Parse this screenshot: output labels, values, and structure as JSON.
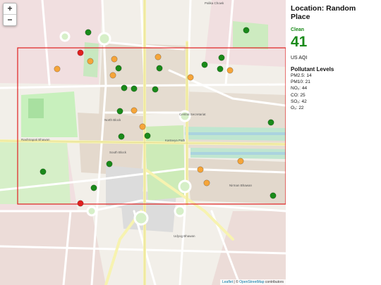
{
  "panel": {
    "location_title": "Location: Random Place",
    "aqi_category": "Clean",
    "aqi_value": "41",
    "aqi_unit": "US AQI",
    "pollutants_heading": "Pollutant Levels",
    "pollutants": [
      "PM2.5: 14",
      "PM10: 21",
      "NO₂: 44",
      "CO: 25",
      "SO₂: 42",
      "O₃: 22"
    ]
  },
  "map": {
    "zoom_in_label": "+",
    "zoom_out_label": "−",
    "attribution": {
      "leaflet": "Leaflet",
      "separator": " | © ",
      "osm": "OpenStreetMap",
      "contributors": " contributors"
    },
    "labels": {
      "palika_chowk": "Palika Chowk",
      "central_secretariat": "Central Secretariat",
      "kartavya_path": "Kartavya Path",
      "udyog_bhawan": "Udyog Bhawan",
      "north_block": "North Block",
      "south_block": "South Block",
      "rashtrapati_bhavan": "Rashtrapati Bhawan",
      "nirman_bhawan": "Nirman Bhawan"
    },
    "colors": {
      "good": "#1a8a1a",
      "moderate": "#f5a53a",
      "unhealthy": "#e02020",
      "selection": "#e02020",
      "category_text": "#1a8a1a"
    },
    "markers": [
      {
        "level": "good"
      },
      {
        "level": "good"
      },
      {
        "level": "good"
      },
      {
        "level": "good"
      },
      {
        "level": "good"
      },
      {
        "level": "good"
      },
      {
        "level": "good"
      },
      {
        "level": "good"
      },
      {
        "level": "good"
      },
      {
        "level": "good"
      },
      {
        "level": "good"
      },
      {
        "level": "good"
      },
      {
        "level": "good"
      },
      {
        "level": "good"
      },
      {
        "level": "good"
      },
      {
        "level": "good"
      },
      {
        "level": "good"
      },
      {
        "level": "good"
      },
      {
        "level": "good"
      },
      {
        "level": "moderate"
      },
      {
        "level": "moderate"
      },
      {
        "level": "moderate"
      },
      {
        "level": "moderate"
      },
      {
        "level": "moderate"
      },
      {
        "level": "moderate"
      },
      {
        "level": "moderate"
      },
      {
        "level": "moderate"
      },
      {
        "level": "moderate"
      },
      {
        "level": "moderate"
      },
      {
        "level": "moderate"
      },
      {
        "level": "moderate"
      },
      {
        "level": "unhealthy"
      },
      {
        "level": "unhealthy"
      }
    ]
  }
}
